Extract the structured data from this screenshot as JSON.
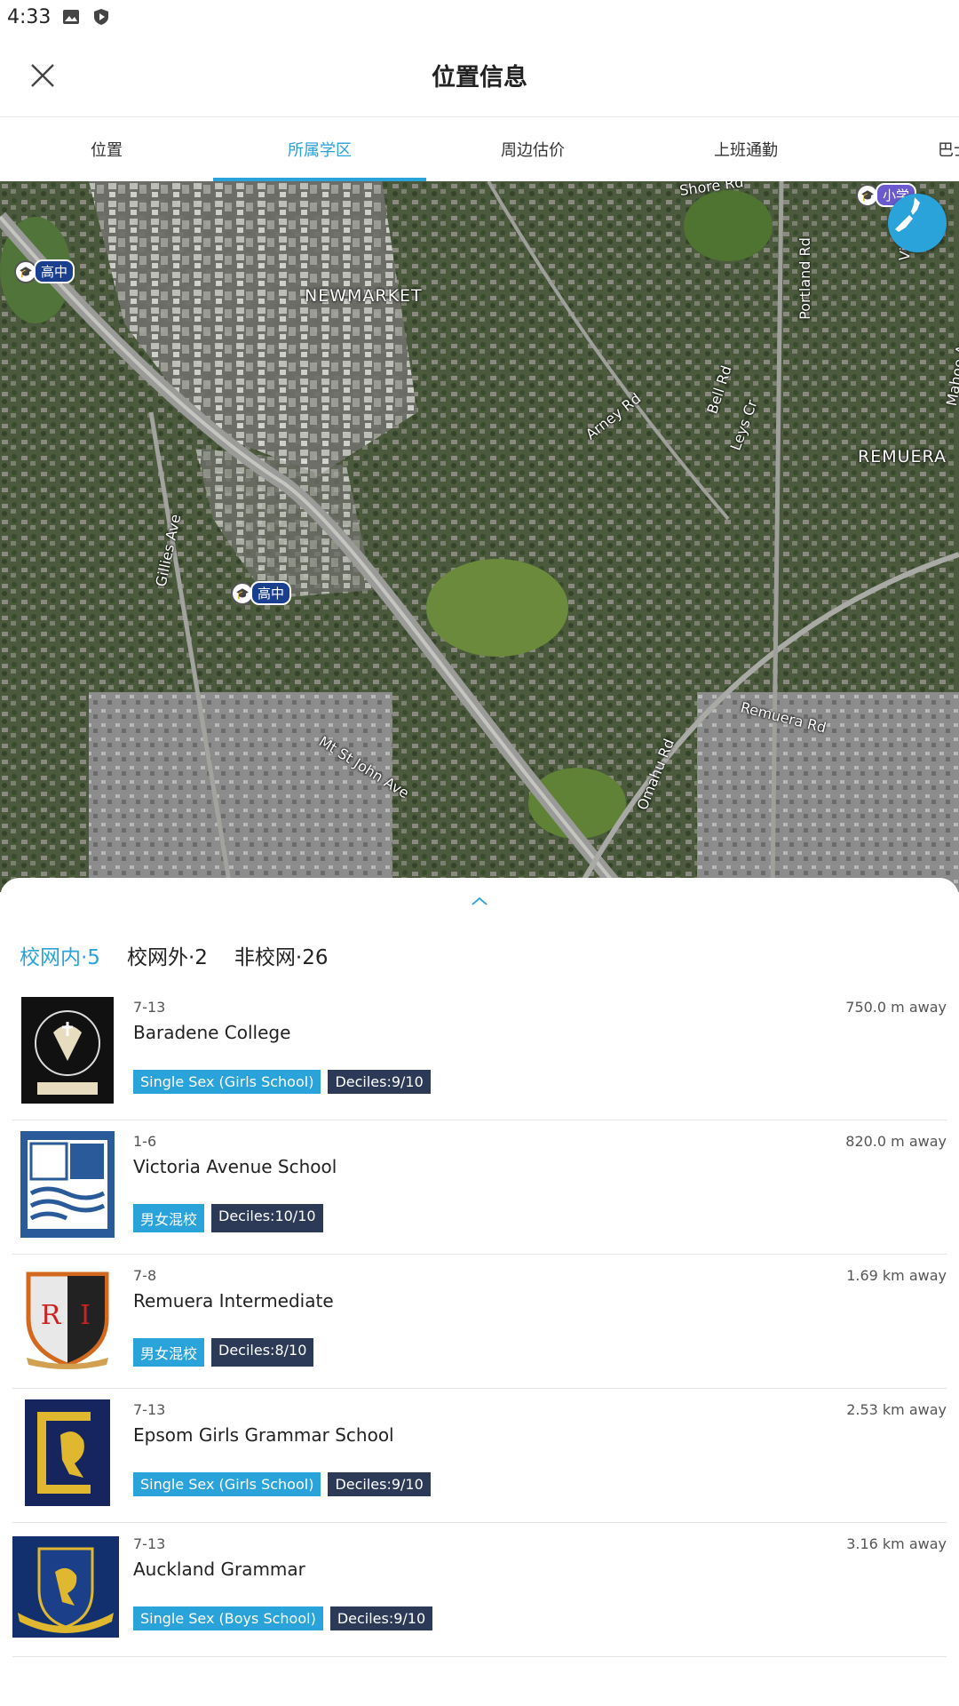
{
  "status_bar": {
    "time": "4:33",
    "icons": [
      "image-icon",
      "shield-icon"
    ]
  },
  "header": {
    "title": "位置信息",
    "close_icon": "close-icon"
  },
  "tabs": [
    {
      "label": "位置",
      "active": false
    },
    {
      "label": "所属学区",
      "active": true
    },
    {
      "label": "周边估价",
      "active": false
    },
    {
      "label": "上班通勤",
      "active": false
    },
    {
      "label": "巴士",
      "active": false
    }
  ],
  "map": {
    "labels": {
      "newmarket": "NEWMARKET",
      "remuera": "REMUERA",
      "shore_rd": "Shore Rd",
      "portland_rd": "Portland Rd",
      "bell_rd": "Bell Rd",
      "arney_rd": "Arney Rd",
      "leys_cr": "Leys Cr",
      "gillies_ave": "Gillies Ave",
      "mt_st_john_ave": "Mt St John Ave",
      "remuera_rd": "Remuera Rd",
      "omahu_rd": "Omahu Rd",
      "victoria": "Victo",
      "mahoe": "Mahoe Ave"
    },
    "pins": {
      "high_school_label": "高中",
      "primary_school_label": "小学"
    },
    "nz_button_icon": "new-zealand-map-icon"
  },
  "sheet": {
    "handle_icon": "chevron-up-icon",
    "filters": [
      {
        "label": "校网内·5",
        "active": true
      },
      {
        "label": "校网外·2",
        "active": false
      },
      {
        "label": "非校网·26",
        "active": false
      }
    ],
    "schools": [
      {
        "grade": "7-13",
        "name": "Baradene College",
        "distance": "750.0 m away",
        "tag1": "Single Sex (Girls School)",
        "tag2": "Deciles:9/10",
        "logo": "baradene-crest-icon"
      },
      {
        "grade": "1-6",
        "name": "Victoria Avenue School",
        "distance": "820.0 m away",
        "tag1": "男女混校",
        "tag2": "Deciles:10/10",
        "logo": "victoria-avenue-crest-icon"
      },
      {
        "grade": "7-8",
        "name": "Remuera Intermediate",
        "distance": "1.69 km away",
        "tag1": "男女混校",
        "tag2": "Deciles:8/10",
        "logo": "remuera-intermediate-crest-icon",
        "logo_text": "R I"
      },
      {
        "grade": "7-13",
        "name": "Epsom Girls Grammar School",
        "distance": "2.53 km away",
        "tag1": "Single Sex (Girls School)",
        "tag2": "Deciles:9/10",
        "logo": "epsom-girls-crest-icon"
      },
      {
        "grade": "7-13",
        "name": "Auckland Grammar",
        "distance": "3.16 km away",
        "tag1": "Single Sex (Boys School)",
        "tag2": "Deciles:9/10",
        "logo": "auckland-grammar-crest-icon"
      }
    ]
  },
  "colors": {
    "accent": "#2aa2da",
    "navy": "#2c3a57"
  }
}
